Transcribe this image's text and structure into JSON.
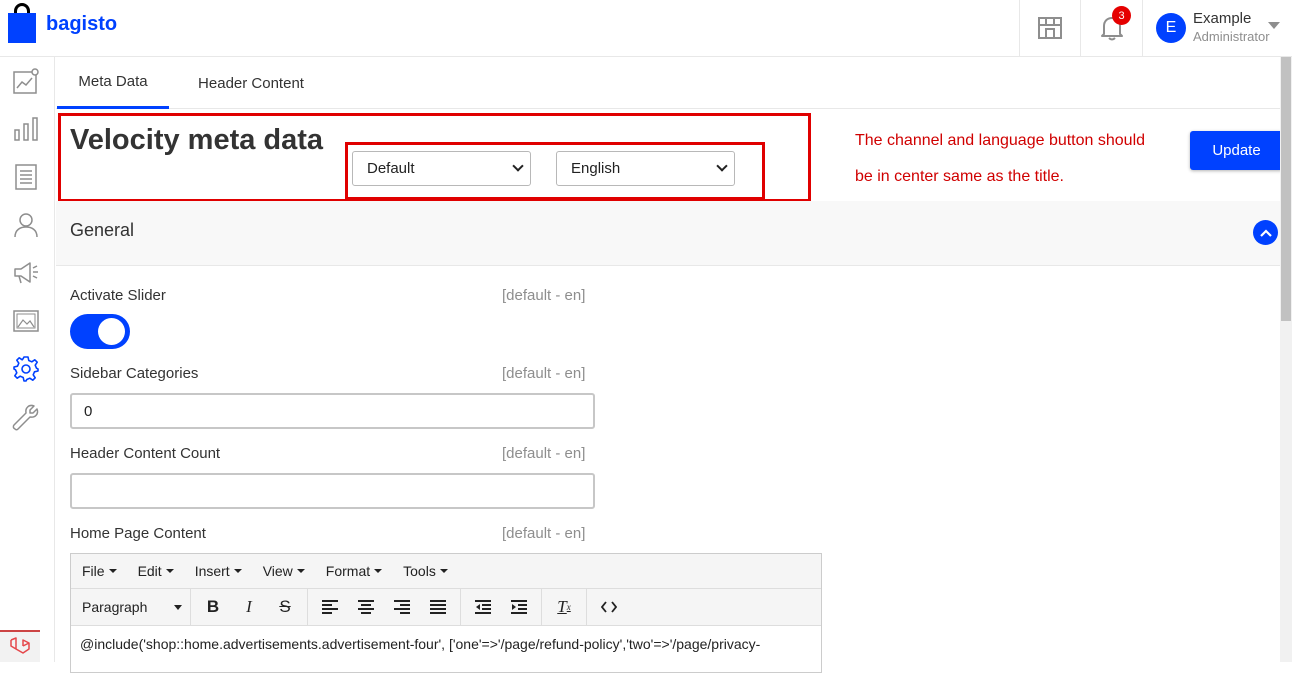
{
  "brand": {
    "name": "bagisto"
  },
  "header": {
    "notification_count": "3",
    "user": {
      "initial": "E",
      "name": "Example",
      "role": "Administrator"
    }
  },
  "sidebar": {
    "items": [
      {
        "icon": "dashboard-icon"
      },
      {
        "icon": "reports-icon"
      },
      {
        "icon": "catalog-icon"
      },
      {
        "icon": "customers-icon"
      },
      {
        "icon": "marketing-icon"
      },
      {
        "icon": "cms-icon"
      },
      {
        "icon": "settings-icon"
      },
      {
        "icon": "tools-icon"
      }
    ]
  },
  "tabs": [
    {
      "label": "Meta Data",
      "active": true
    },
    {
      "label": "Header Content",
      "active": false
    }
  ],
  "page": {
    "title": "Velocity meta data",
    "channel_select": "Default",
    "locale_select": "English",
    "update_label": "Update",
    "annotation_line1": "The channel and language button should",
    "annotation_line2": "be in center same as the title."
  },
  "section": {
    "title": "General",
    "fields": {
      "activate_slider": {
        "label": "Activate Slider",
        "scope": "[default - en]",
        "value": true
      },
      "sidebar_categories": {
        "label": "Sidebar Categories",
        "scope": "[default - en]",
        "value": "0"
      },
      "header_content_count": {
        "label": "Header Content Count",
        "scope": "[default - en]",
        "value": ""
      },
      "home_page_content": {
        "label": "Home Page Content",
        "scope": "[default - en]"
      }
    }
  },
  "editor": {
    "menus": [
      "File",
      "Edit",
      "Insert",
      "View",
      "Format",
      "Tools"
    ],
    "paragraph": "Paragraph",
    "content": "@include('shop::home.advertisements.advertisement-four', ['one'=>'/page/refund-policy','two'=>'/page/privacy-"
  },
  "colors": {
    "accent": "#0041ff",
    "annotation": "#e00000",
    "badge": "#e50000"
  }
}
